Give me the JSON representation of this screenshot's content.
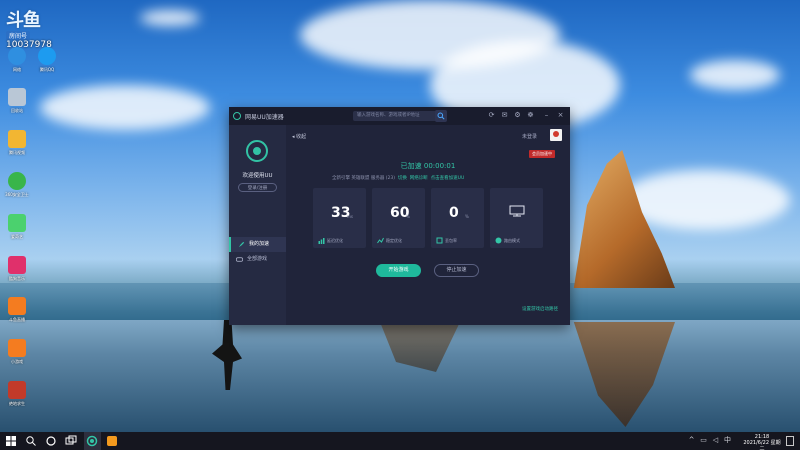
{
  "desktop": {
    "watermark": {
      "logo": "斗鱼",
      "room_label": "房间号",
      "room_number": "10037978"
    },
    "icons": [
      {
        "name": "edge",
        "label": "网络",
        "color": "#2f8fe0"
      },
      {
        "name": "qq",
        "label": "腾讯QQ",
        "color": "#1d9bf0"
      },
      {
        "name": "recycle-bin",
        "label": "回收站",
        "color": "#b9c7d6"
      },
      {
        "name": "folder",
        "label": "腾讯视频",
        "color": "#f2b632"
      },
      {
        "name": "app-360",
        "label": "360安全卫士",
        "color": "#39b54a"
      },
      {
        "name": "player",
        "label": "爱奇艺",
        "color": "#4bd16e"
      },
      {
        "name": "music",
        "label": "酷狗音乐",
        "color": "#e0306b"
      },
      {
        "name": "game-a",
        "label": "斗鱼直播",
        "color": "#f47c20"
      },
      {
        "name": "game-b",
        "label": "小游戏",
        "color": "#f47c20"
      },
      {
        "name": "game-c",
        "label": "绝地求生",
        "color": "#c23a2a"
      }
    ]
  },
  "app": {
    "title": "网易UU加速器",
    "search_placeholder": "输入游戏名称、游戏或者IP地址",
    "welcome": "欢迎使用UU",
    "login_button": "登录/注册",
    "nav": [
      {
        "label": "我的加速",
        "icon": "rocket-icon",
        "active": true
      },
      {
        "label": "全部游戏",
        "icon": "gamepad-icon",
        "active": false
      }
    ],
    "back_label": "收起",
    "top_hint": "未登录",
    "vip_badge": "会员加速中",
    "status": "已加速 00:00:01",
    "game_info": {
      "prefix": "全新引擎  英雄联盟  服务器 (23)",
      "link1": "切换",
      "link2": "网络诊断",
      "link3": "点击查看加速UU"
    },
    "cards": [
      {
        "value": "33",
        "unit": "ms",
        "caption": "延迟优化",
        "icon": "bars-icon"
      },
      {
        "value": "60",
        "unit": "%",
        "caption": "稳定优化",
        "icon": "trend-icon"
      },
      {
        "value": "0",
        "unit": "%",
        "caption": "丢包率",
        "icon": "packet-icon"
      },
      {
        "value": "",
        "unit": "",
        "caption": "路由模式",
        "icon": "monitor-icon"
      }
    ],
    "accelerate_button": "开始游戏",
    "stop_button": "停止加速",
    "settings_link": "设置游戏启动路径"
  },
  "taskbar": {
    "time": "21:18",
    "date": "2021/6/22 星期二"
  },
  "colors": {
    "accent": "#33c6a7",
    "window_bg": "#20243a",
    "sidebar_bg": "#252a42"
  }
}
